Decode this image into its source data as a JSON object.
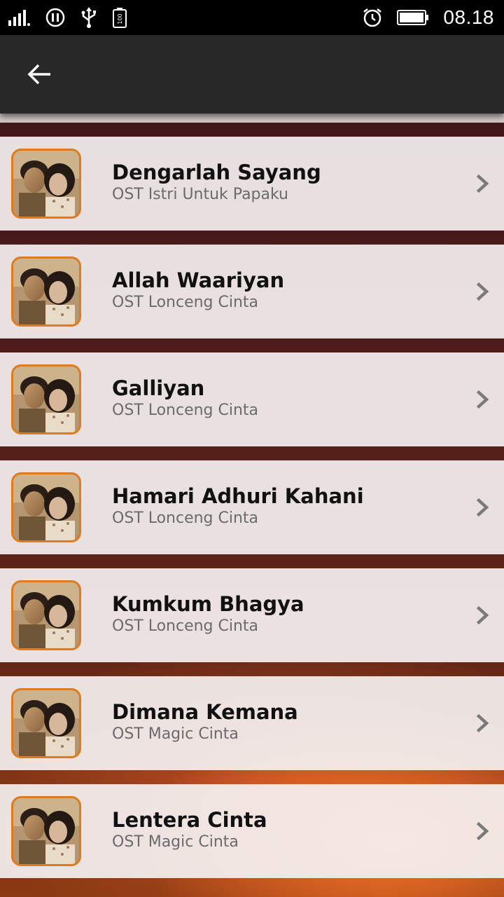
{
  "status_bar": {
    "time": "08.18",
    "battery_badge": "100",
    "icons": [
      "signal-icon",
      "pause-circle-icon",
      "usb-icon",
      "battery-small-icon",
      "alarm-icon",
      "battery-icon"
    ]
  },
  "app_bar": {
    "back_icon": "arrow-left-icon"
  },
  "songs": [
    {
      "title": "Dengarlah Sayang",
      "subtitle": "OST Istri Untuk Papaku"
    },
    {
      "title": "Allah Waariyan",
      "subtitle": "OST Lonceng Cinta"
    },
    {
      "title": "Galliyan",
      "subtitle": "OST Lonceng Cinta"
    },
    {
      "title": "Hamari Adhuri Kahani",
      "subtitle": "OST Lonceng Cinta"
    },
    {
      "title": "Kumkum Bhagya",
      "subtitle": "OST Lonceng Cinta"
    },
    {
      "title": "Dimana Kemana",
      "subtitle": "OST Magic Cinta"
    },
    {
      "title": "Lentera Cinta",
      "subtitle": "OST Magic Cinta"
    }
  ],
  "colors": {
    "thumbnail_border": "#e07a1e",
    "app_bar": "#282828",
    "item_background": "#f4f0f0"
  }
}
